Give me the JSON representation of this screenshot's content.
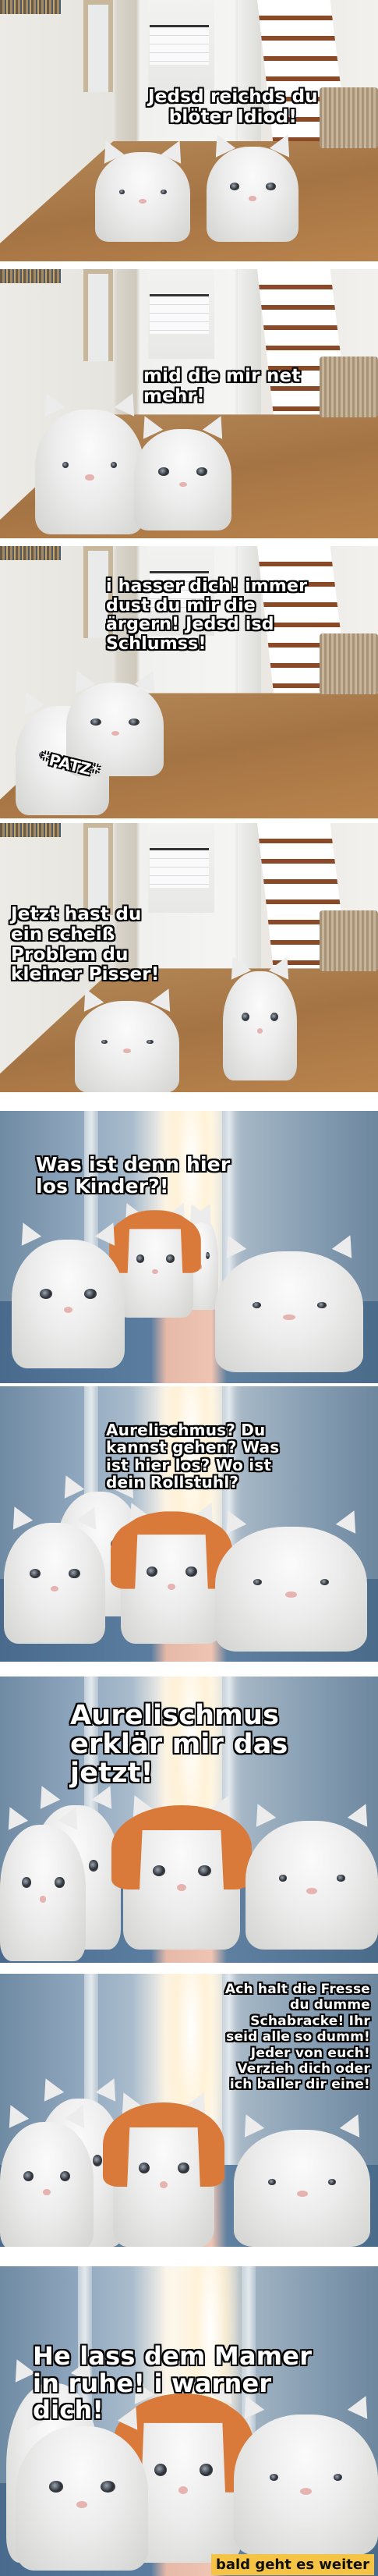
{
  "panels": [
    {
      "caption": "Jedsd reichds du\nblöter Idiod!"
    },
    {
      "caption": "mid die mir net\nmehr!"
    },
    {
      "caption": "i hasser dich! immer\ndust du mir die\närgern! Jedsd isd\nSchlumss!",
      "sound": "*PATZ*"
    },
    {
      "caption": "Jetzt hast du\nein scheiß\nProblem du\nkleiner Pisser!"
    },
    {
      "caption": "Was ist denn hier\nlos Kinder?!"
    },
    {
      "caption": "Aurelischmus? Du\nkannst gehen? Was\nist hier los? Wo ist\ndein Rollstuhl?"
    },
    {
      "caption": "Aurelischmus\nerklär mir das\njetzt!"
    },
    {
      "caption": "Ach halt die Fresse\ndu dumme\nSchabracke! Ihr\nseid alle so dumm!\nJeder von euch!\nVerzieh dich oder\nich baller dir eine!"
    },
    {
      "caption": "He lass dem Mamer\nin ruhe! i warner\ndich!",
      "banner": "bald geht es weiter"
    }
  ],
  "colors": {
    "banner": "#f6c445",
    "wig": "#d9793a"
  }
}
